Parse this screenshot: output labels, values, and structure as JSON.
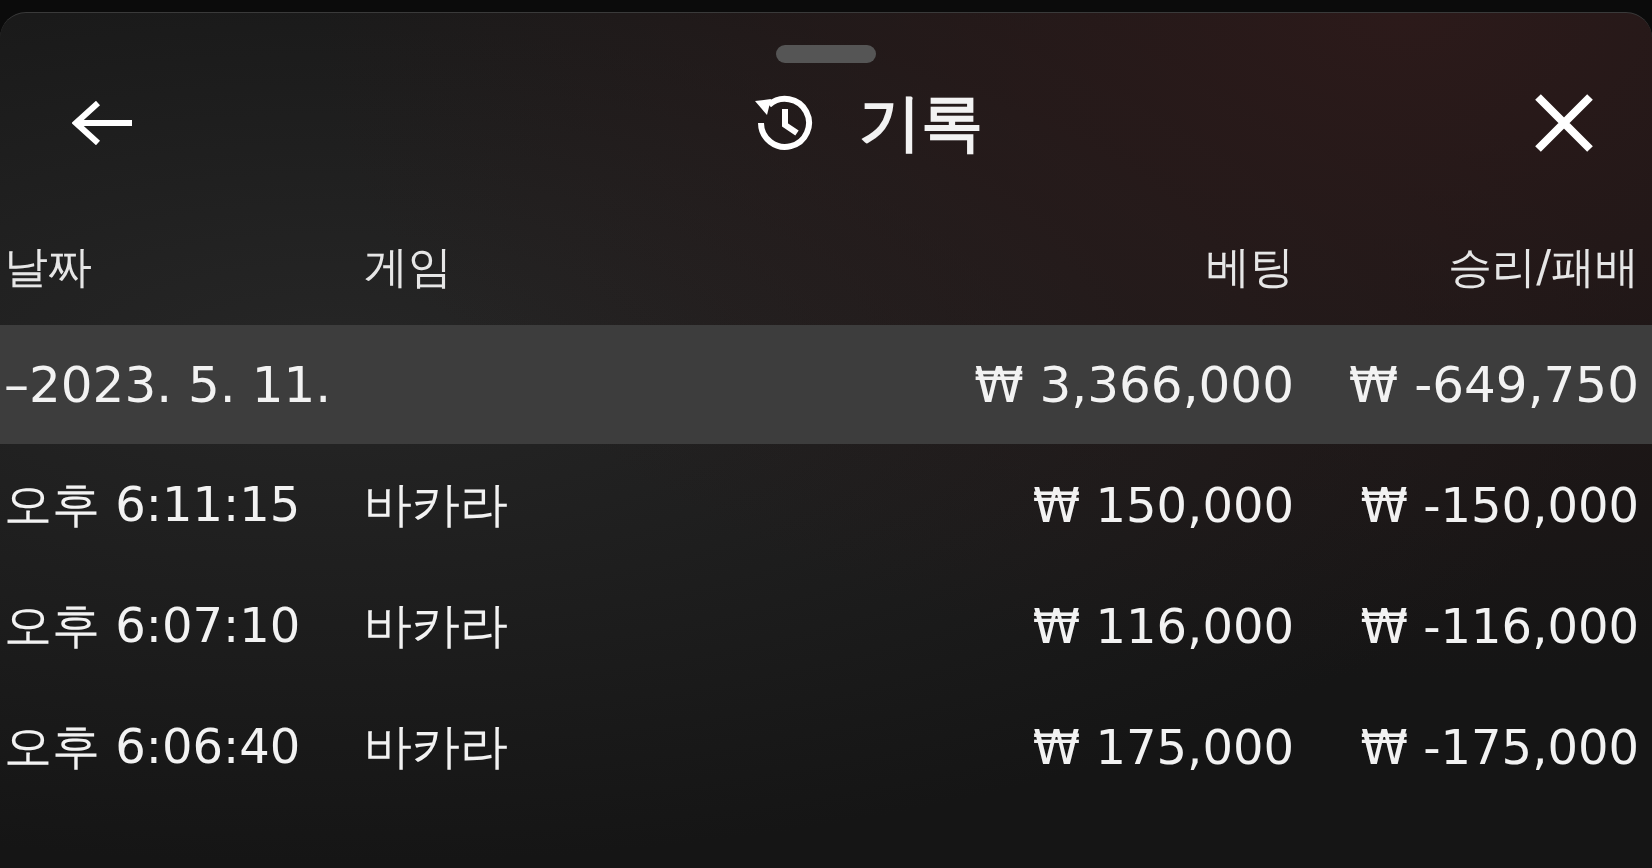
{
  "header": {
    "title": "기록"
  },
  "table": {
    "columns": [
      "날짜",
      "게임",
      "베팅",
      "승리/패배"
    ],
    "summary": {
      "date": "–2023. 5. 11.",
      "bet": "₩ 3,366,000",
      "result": "₩ -649,750",
      "selected": true
    },
    "rows": [
      {
        "time": "오후 6:11:15",
        "game": "바카라",
        "bet": "₩ 150,000",
        "result": "₩ -150,000"
      },
      {
        "time": "오후 6:07:10",
        "game": "바카라",
        "bet": "₩ 116,000",
        "result": "₩ -116,000"
      },
      {
        "time": "오후 6:06:40",
        "game": "바카라",
        "bet": "₩ 175,000",
        "result": "₩ -175,000"
      }
    ]
  }
}
